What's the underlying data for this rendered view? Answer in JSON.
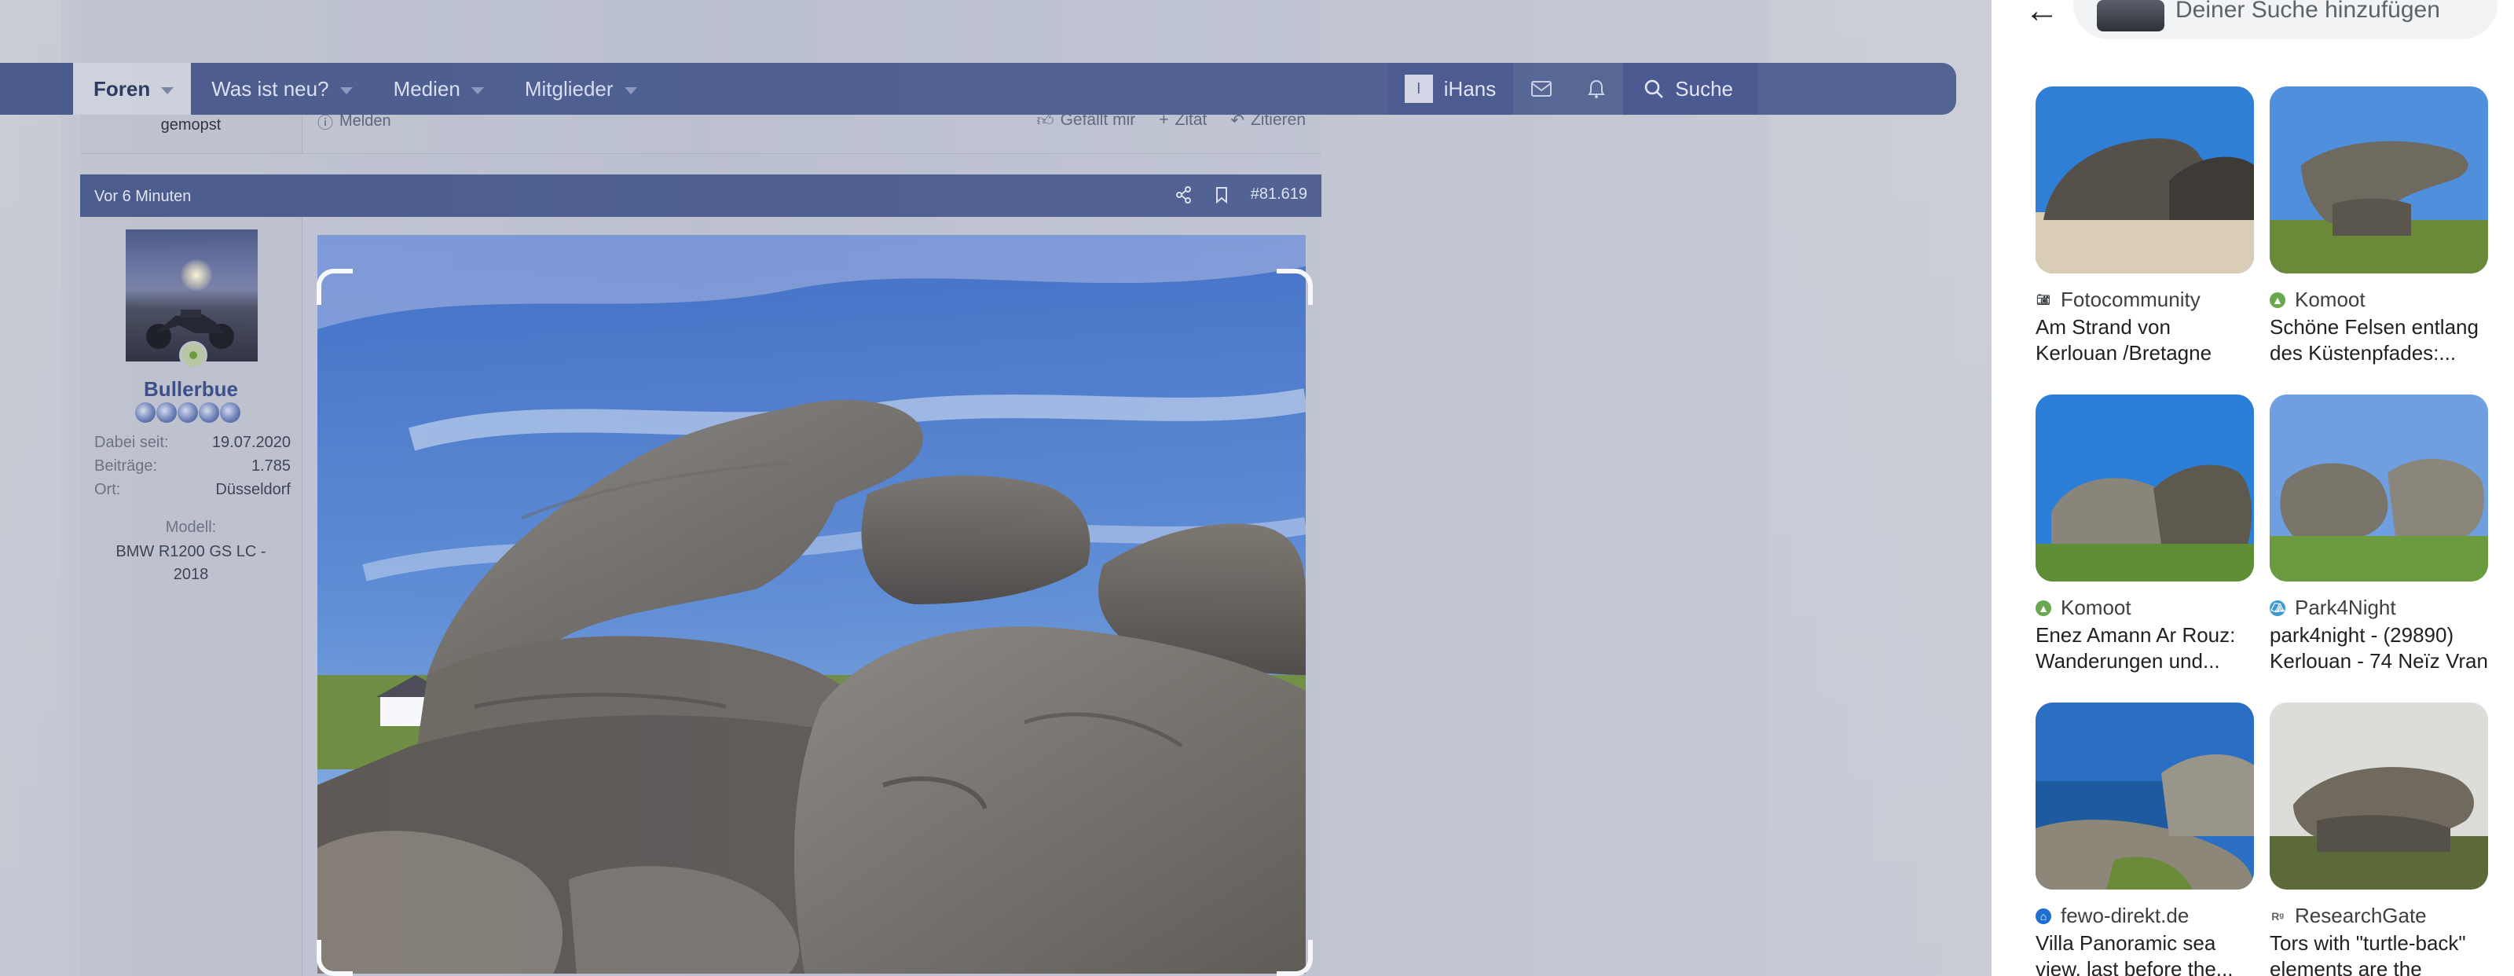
{
  "nav": {
    "tabs": [
      {
        "label": "Foren",
        "active": true
      },
      {
        "label": "Was ist neu?"
      },
      {
        "label": "Medien"
      },
      {
        "label": "Mitglieder"
      }
    ],
    "user_initial": "I",
    "user_name": "iHans",
    "search_label": "Suche"
  },
  "previous_post": {
    "username": "gemopst",
    "report_label": "Melden",
    "like_label": "Gefällt mir",
    "quote_label": "Zitat",
    "reply_label": "Zitieren"
  },
  "post": {
    "time": "Vor 6 Minuten",
    "number": "#81.619",
    "user": {
      "name": "Bullerbue",
      "rank_stars": 5,
      "joined_label": "Dabei seit:",
      "joined_value": "19.07.2020",
      "posts_label": "Beiträge:",
      "posts_value": "1.785",
      "location_label": "Ort:",
      "location_value": "Düsseldorf",
      "model_label": "Modell:",
      "model_value": "BMW R1200 GS LC - 2018"
    }
  },
  "lens": {
    "search_placeholder": "Deiner Suche hinzufügen",
    "results": [
      {
        "source": "Fotocommunity",
        "title": "Am Strand von Kerlouan /Bretagne Foto & Bild |...",
        "icon_color": "#3c4043",
        "icon": "camera-icon"
      },
      {
        "source": "Komoot",
        "title": "Schöne Felsen entlang des Küstenpfades:...",
        "icon_color": "#6aa84f",
        "icon": "komoot-icon"
      },
      {
        "source": "Komoot",
        "title": "Enez Amann Ar Rouz: Wanderungen und...",
        "icon_color": "#6aa84f",
        "icon": "komoot-icon"
      },
      {
        "source": "Park4Night",
        "title": "park4night - (29890) Kerlouan - 74 Neïz Vran",
        "icon_color": "#3d9ad1",
        "icon": "park4night-icon"
      },
      {
        "source": "fewo-direkt.de",
        "title": "Villa Panoramic sea view, last before the...",
        "icon_color": "#1f6fd1",
        "icon": "fewo-icon"
      },
      {
        "source": "ResearchGate",
        "title": "Tors with \"turtle-back\" elements are the resul...",
        "icon_color": "#5f6368",
        "icon": "researchgate-icon"
      }
    ]
  },
  "colors": {
    "nav_bg": "#4b5c8c",
    "username": "#3a4f8a",
    "lens_bg": "#ffffff"
  }
}
